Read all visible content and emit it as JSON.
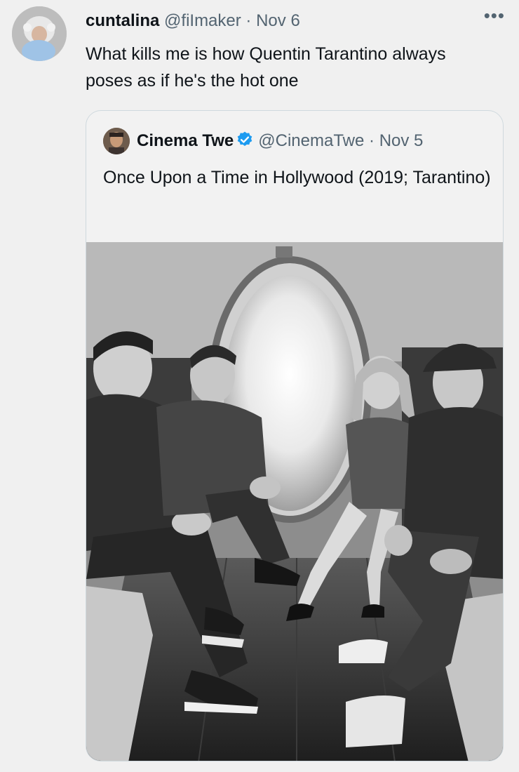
{
  "tweet": {
    "display_name": "cuntalina",
    "handle": "@fiImaker",
    "separator": "·",
    "date": "Nov 6",
    "more_icon": "more-horizontal-icon",
    "text": "What kills me is how Quentin Tarantino always poses as if he's the hot one"
  },
  "quote": {
    "display_name": "Cinema Twe",
    "handle": "@CinemaTwe",
    "separator": "·",
    "date": "Nov 5",
    "verified_icon": "verified-badge-icon",
    "verified_color": "#1d9bf0",
    "text": "Once Upon a Time in Hollywood (2019; Tarantino)",
    "media": "black-and-white photo"
  }
}
